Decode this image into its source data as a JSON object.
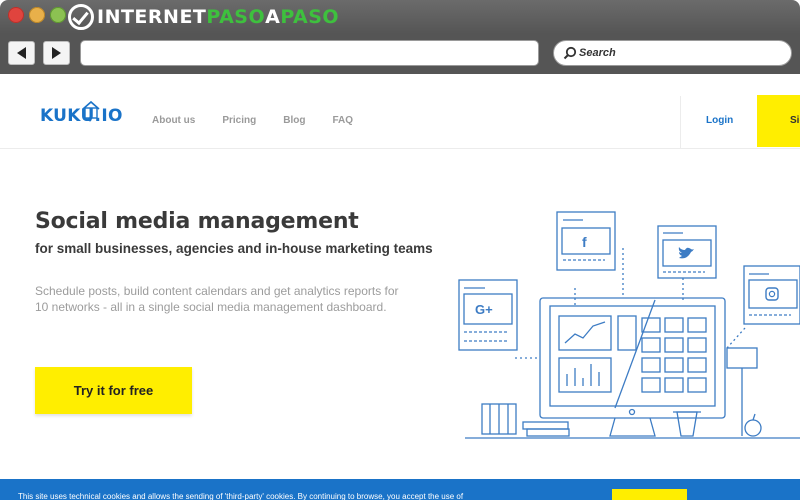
{
  "browser": {
    "brand_part1": "INTERNET",
    "brand_part2": "PASO",
    "brand_part3": "A",
    "brand_part4": "PASO",
    "url": "",
    "search_placeholder": "Search"
  },
  "site": {
    "logo_text": "KUKU.IO",
    "nav": [
      "About us",
      "Pricing",
      "Blog",
      "FAQ"
    ],
    "login_label": "Login",
    "signup_label": "Sig"
  },
  "hero": {
    "title": "Social media management",
    "subtitle": "for small businesses, agencies and in-house marketing teams",
    "description": "Schedule posts, build content calendars and get analytics reports for 10 networks - all in a single social media management dashboard.",
    "cta_label": "Try it for free"
  },
  "cookie": {
    "text": "This site uses technical cookies and allows the sending of 'third-party' cookies. By continuing to browse, you accept the use of"
  },
  "colors": {
    "accent_blue": "#1a73c8",
    "accent_yellow": "#ffee00",
    "chrome_gray": "#555555",
    "brand_green": "#3ec03e"
  },
  "icons": [
    "back-arrow-icon",
    "forward-arrow-icon",
    "search-icon",
    "facebook-icon",
    "twitter-icon",
    "google-plus-icon",
    "instagram-icon"
  ]
}
